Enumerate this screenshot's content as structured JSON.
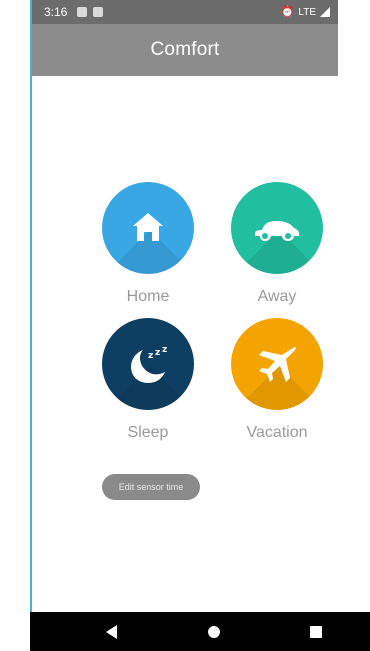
{
  "status_bar": {
    "time": "3:16",
    "network": "LTE"
  },
  "app_bar": {
    "title": "Comfort"
  },
  "modes": [
    {
      "label": "Home",
      "color": "#39a7e3",
      "icon": "house-icon"
    },
    {
      "label": "Away",
      "color": "#21bea0",
      "icon": "car-icon"
    },
    {
      "label": "Sleep",
      "color": "#0e3f63",
      "icon": "moon-sleep-icon"
    },
    {
      "label": "Vacation",
      "color": "#f3a400",
      "icon": "airplane-icon"
    }
  ],
  "edit_button": {
    "label": "Edit sensor time"
  },
  "colors": {
    "status_bar": "#6c6c6c",
    "app_bar": "#8c8c8c",
    "label": "#9a9a9a",
    "edit_button": "#8a8a8a"
  }
}
